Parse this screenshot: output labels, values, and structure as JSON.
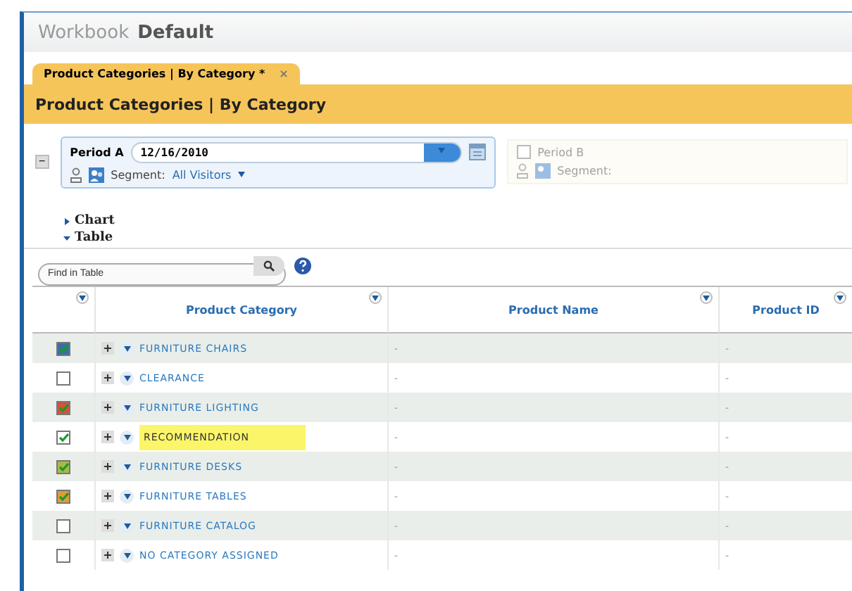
{
  "window": {
    "title_label": "Workbook",
    "title": "Default"
  },
  "tabs": [
    {
      "label": "Product Categories | By Category *",
      "close": "×",
      "selected": true
    }
  ],
  "header": "Product Categories | By Category",
  "period_a": {
    "label": "Period A",
    "date": "12/16/2010",
    "segment_label": "Segment:",
    "segment": "All Visitors",
    "collapse": "−"
  },
  "period_b": {
    "label": "Period B",
    "checked": false,
    "segment_label": "Segment:"
  },
  "sections": [
    {
      "label": "Chart",
      "expanded": false
    },
    {
      "label": "Table",
      "expanded": true
    }
  ],
  "search": {
    "placeholder": "Find in Table"
  },
  "table": {
    "columns": [
      "Product Category",
      "Product Name",
      "Product ID"
    ],
    "rows": [
      {
        "category": "FURNITURE CHAIRS",
        "checked": true,
        "color": "#3a6ea8",
        "highlighted": false,
        "name": "-",
        "id": "-"
      },
      {
        "category": "CLEARANCE",
        "checked": false,
        "color": "#ffffff",
        "highlighted": false,
        "name": "-",
        "id": "-"
      },
      {
        "category": "FURNITURE LIGHTING",
        "checked": true,
        "color": "#d0553a",
        "highlighted": false,
        "name": "-",
        "id": "-"
      },
      {
        "category": "RECOMMENDATION",
        "checked": true,
        "color": "#ffffff",
        "highlighted": true,
        "name": "-",
        "id": "-"
      },
      {
        "category": "FURNITURE DESKS",
        "checked": true,
        "color": "#a8b848",
        "highlighted": false,
        "name": "-",
        "id": "-"
      },
      {
        "category": "FURNITURE TABLES",
        "checked": true,
        "color": "#e09a3a",
        "highlighted": false,
        "name": "-",
        "id": "-"
      },
      {
        "category": "FURNITURE CATALOG",
        "checked": false,
        "color": "#ffffff",
        "highlighted": false,
        "name": "-",
        "id": "-"
      },
      {
        "category": "NO CATEGORY ASSIGNED",
        "checked": false,
        "color": "#ffffff",
        "highlighted": false,
        "name": "-",
        "id": "-"
      }
    ]
  }
}
